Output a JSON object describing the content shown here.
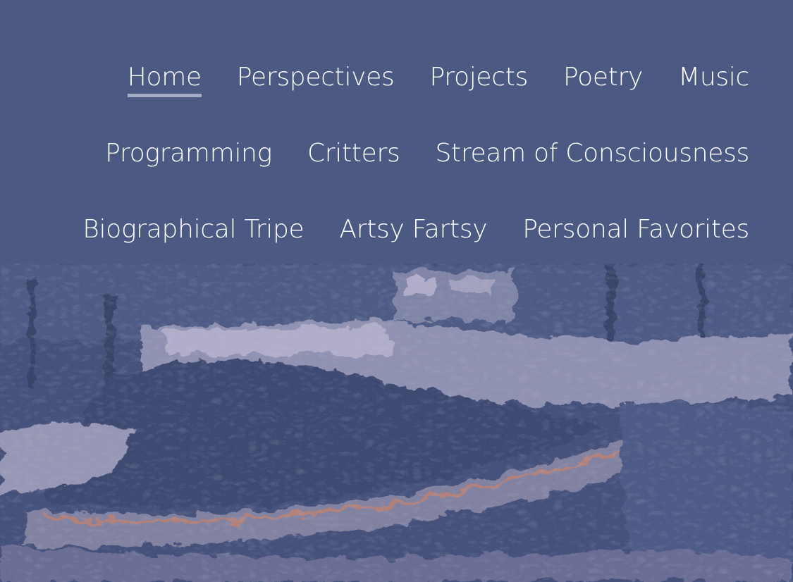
{
  "nav": {
    "items": [
      {
        "label": "Home",
        "active": true
      },
      {
        "label": "Perspectives",
        "active": false
      },
      {
        "label": "Projects",
        "active": false
      },
      {
        "label": "Poetry",
        "active": false
      },
      {
        "label": "Music",
        "active": false
      },
      {
        "label": "Programming",
        "active": false
      },
      {
        "label": "Critters",
        "active": false
      },
      {
        "label": "Stream of Consciousness",
        "active": false
      },
      {
        "label": "Biographical Tripe",
        "active": false
      },
      {
        "label": "Artsy Fartsy",
        "active": false
      },
      {
        "label": "Personal Favorites",
        "active": false
      }
    ]
  },
  "colors": {
    "nav_background": "#4c5a83",
    "nav_text": "#ffffff",
    "active_underline": "#a4acc6",
    "hero_base": "#3e4c78",
    "hero_highlight": "#c9c3dc",
    "hero_accent": "#c98a78"
  },
  "hero": {
    "image": "stylized-painting-of-garden-yard-with-trees-and-curved-stone-border"
  }
}
